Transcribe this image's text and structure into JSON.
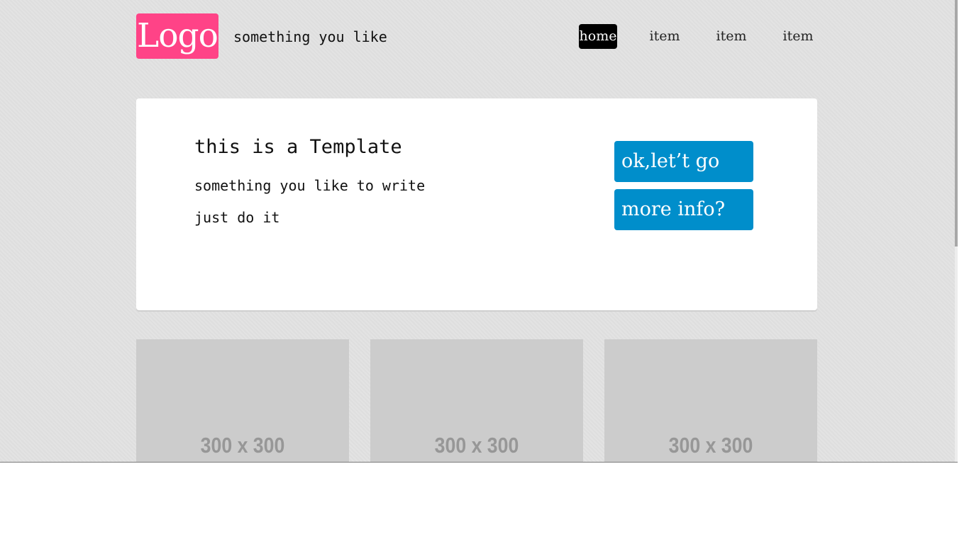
{
  "header": {
    "logo_text": "Logo",
    "tagline": "something you like",
    "nav": [
      "home",
      "item",
      "item",
      "item"
    ]
  },
  "hero": {
    "title": "this is a Template",
    "subtitle": "something you like to write",
    "line2": "just do it",
    "primary_button": "ok,let’t go",
    "secondary_button": "more info?"
  },
  "thumbnails": [
    {
      "label": "300 x 300"
    },
    {
      "label": "300 x 300"
    },
    {
      "label": "300 x 300"
    }
  ],
  "colors": {
    "logo_bg": "#ff4387",
    "button_bg": "#008ecb",
    "active_nav_bg": "#000000",
    "placeholder_bg": "#cccccc"
  }
}
